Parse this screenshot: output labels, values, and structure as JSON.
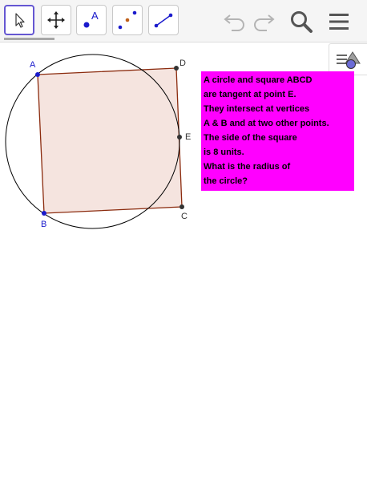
{
  "toolbar": {
    "tools": [
      {
        "name": "move-tool",
        "icon": "arrow-pointer-icon",
        "selected": true
      },
      {
        "name": "move-graphics-view-tool",
        "icon": "four-way-arrow-icon",
        "selected": false
      },
      {
        "name": "point-tool",
        "icon": "point-icon",
        "label": "A",
        "selected": false
      },
      {
        "name": "line-tool",
        "icon": "line-through-points-icon",
        "selected": false
      },
      {
        "name": "segment-tool",
        "icon": "segment-icon",
        "selected": false
      }
    ],
    "actions": [
      "undo-icon",
      "redo-icon",
      "search-icon",
      "menu-icon"
    ],
    "style_bar_icon": "style-bar-toggle-icon"
  },
  "construction": {
    "points": [
      {
        "label": "A",
        "color": "#1a1acc"
      },
      {
        "label": "B",
        "color": "#1a1acc"
      },
      {
        "label": "C",
        "color": "#333333"
      },
      {
        "label": "D",
        "color": "#333333"
      },
      {
        "label": "E",
        "color": "#333333"
      }
    ],
    "square_fill": "#f5e4df",
    "square_stroke": "#8b2b0e",
    "circle_stroke": "#000000"
  },
  "textbox": {
    "lines": [
      "A circle and square ABCD",
      "are tangent at point E.",
      "They intersect at vertices",
      "A & B and at two other points.",
      "The side of the square",
      "is 8 units.",
      "What is the radius of",
      "the circle?"
    ],
    "background": "#ff00ff"
  },
  "colors": {
    "accent": "#6557d2",
    "toolbar_bg": "#f5f5f5"
  }
}
